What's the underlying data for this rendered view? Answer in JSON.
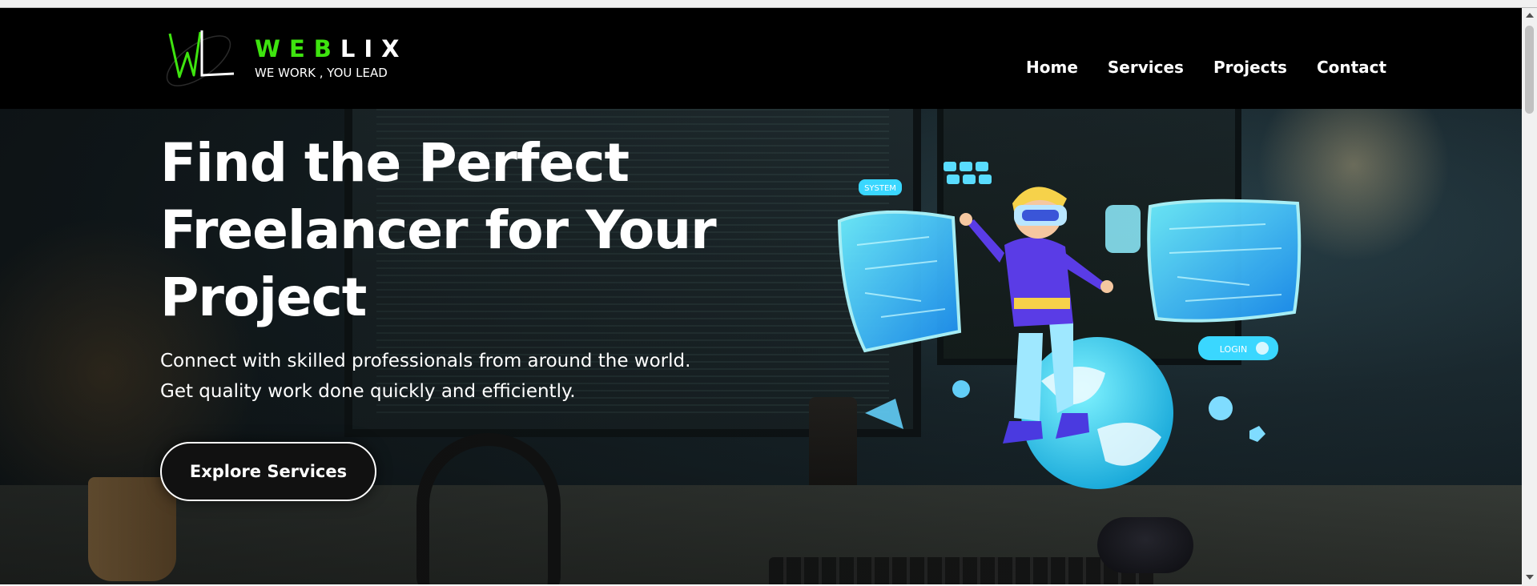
{
  "brand": {
    "name_part1": "WEB",
    "name_part2": "LIX",
    "tagline": "WE WORK , YOU LEAD",
    "logo_icon": "wl-monogram-logo",
    "accent_color": "#3ee40f"
  },
  "nav": {
    "items": [
      {
        "label": "Home"
      },
      {
        "label": "Services"
      },
      {
        "label": "Projects"
      },
      {
        "label": "Contact"
      }
    ]
  },
  "hero": {
    "title_line1": "Find the Perfect",
    "title_line2": "Freelancer for Your",
    "title_line3": "Project",
    "subtitle_line1": "Connect with skilled professionals from around the world.",
    "subtitle_line2": "Get quality work done quickly and efficiently.",
    "cta_label": "Explore Services",
    "illustration": {
      "panel_left_label": "SYSTEM",
      "panel_right_label": "LOGIN"
    }
  },
  "colors": {
    "header_bg": "#000000",
    "text": "#ffffff",
    "cta_bg": "#111111",
    "illustration_cyan": "#3ad7ff",
    "illustration_purple": "#5a3ce6"
  }
}
